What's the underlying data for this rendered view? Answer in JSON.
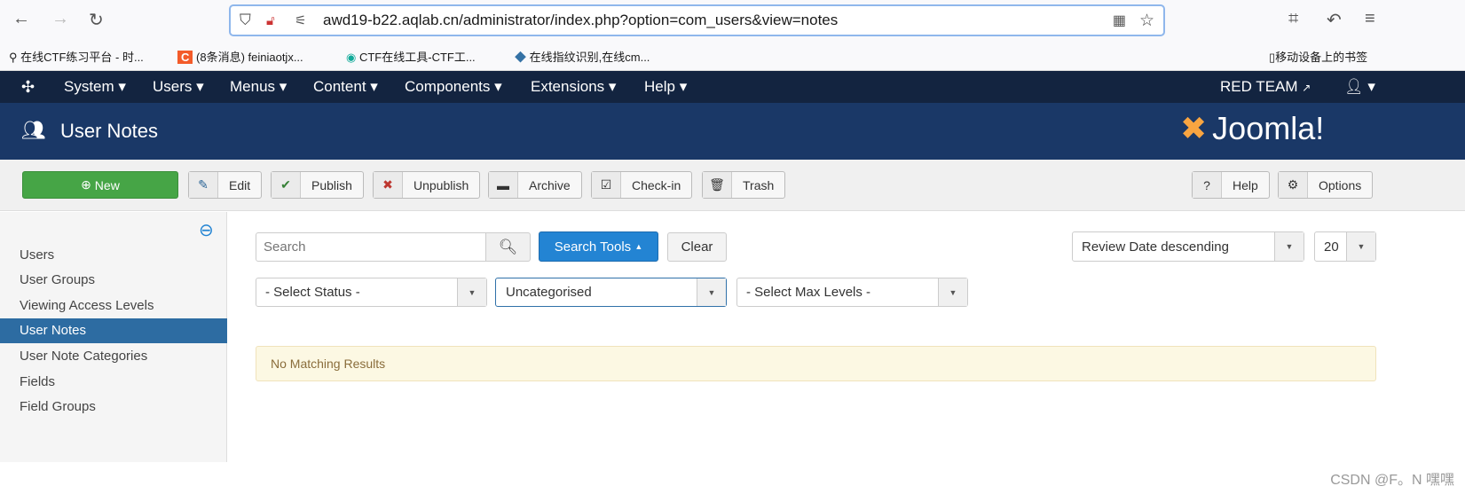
{
  "browser": {
    "url": "awd19-b22.aqlab.cn/administrator/index.php?option=com_users&view=notes",
    "bookmarks": [
      "在线CTF练习平台 - 时...",
      "(8条消息) feiniaotjx...",
      "CTF在线工具-CTF工...",
      "在线指纹识别,在线cm..."
    ],
    "mobile_bookmarks": "移动设备上的书签"
  },
  "topnav": {
    "menus": [
      "System",
      "Users",
      "Menus",
      "Content",
      "Components",
      "Extensions",
      "Help"
    ],
    "site": "RED TEAM"
  },
  "header": {
    "title": "User Notes",
    "logo": "Joomla!"
  },
  "toolbar": {
    "new": "New",
    "edit": "Edit",
    "publish": "Publish",
    "unpublish": "Unpublish",
    "archive": "Archive",
    "checkin": "Check-in",
    "trash": "Trash",
    "help": "Help",
    "options": "Options"
  },
  "sidebar": {
    "items": [
      "Users",
      "User Groups",
      "Viewing Access Levels",
      "User Notes",
      "User Note Categories",
      "Fields",
      "Field Groups"
    ],
    "active": "User Notes"
  },
  "filters": {
    "search_placeholder": "Search",
    "search_tools": "Search Tools",
    "clear": "Clear",
    "ordering": "Review Date descending",
    "limit": "20",
    "status": "- Select Status -",
    "category": "Uncategorised",
    "max_levels": "- Select Max Levels -"
  },
  "message": "No Matching Results",
  "watermark": "CSDN @F。N 嘿嘿",
  "colors": {
    "nav": "#132440",
    "header": "#1a3867",
    "new_button": "#46a546",
    "primary": "#2384d3",
    "active_item": "#2d6ca2",
    "alert_bg": "#fcf8e3"
  }
}
